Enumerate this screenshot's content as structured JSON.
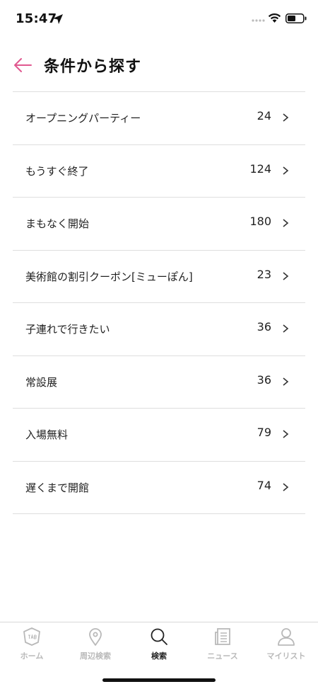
{
  "status_bar": {
    "time": "15:47"
  },
  "header": {
    "title": "条件から探す"
  },
  "list": [
    {
      "label": "オープニングパーティー",
      "count": "24"
    },
    {
      "label": "もうすぐ終了",
      "count": "124"
    },
    {
      "label": "まもなく開始",
      "count": "180"
    },
    {
      "label": "美術館の割引クーポン[ミューぽん]",
      "count": "23"
    },
    {
      "label": "子連れで行きたい",
      "count": "36"
    },
    {
      "label": "常設展",
      "count": "36"
    },
    {
      "label": "入場無料",
      "count": "79"
    },
    {
      "label": "遅くまで開館",
      "count": "74"
    }
  ],
  "tabs": [
    {
      "label": "ホーム",
      "icon": "tab-logo-icon",
      "active": false
    },
    {
      "label": "周辺検索",
      "icon": "location-pin-icon",
      "active": false
    },
    {
      "label": "検索",
      "icon": "search-icon",
      "active": true
    },
    {
      "label": "ニュース",
      "icon": "news-icon",
      "active": false
    },
    {
      "label": "マイリスト",
      "icon": "person-icon",
      "active": false
    }
  ],
  "colors": {
    "accent": "#e0588f",
    "inactive": "#b9b9b9",
    "active": "#222222",
    "divider": "#dedede"
  }
}
